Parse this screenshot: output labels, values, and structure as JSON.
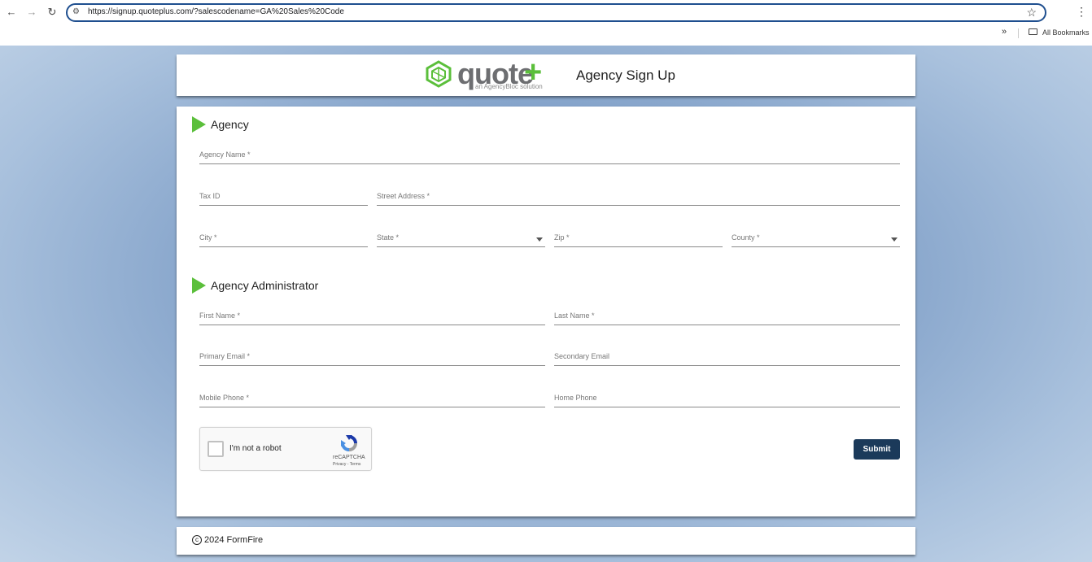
{
  "browser": {
    "url": "https://signup.quoteplus.com/?salescodename=GA%20Sales%20Code",
    "bookmarks_label": "All Bookmarks",
    "more_bookmarks": "»"
  },
  "header": {
    "logo_word": "quote",
    "logo_plus": "+",
    "logo_sub": "an AgencyBloc solution",
    "title": "Agency Sign Up"
  },
  "agency": {
    "section_title": "Agency",
    "agency_name": "Agency Name *",
    "tax_id": "Tax ID",
    "street_address": "Street Address *",
    "city": "City *",
    "state": "State *",
    "zip": "Zip *",
    "county": "County *"
  },
  "admin": {
    "section_title": "Agency Administrator",
    "first_name": "First Name *",
    "last_name": "Last Name *",
    "primary_email": "Primary Email *",
    "secondary_email": "Secondary Email",
    "mobile_phone": "Mobile Phone *",
    "home_phone": "Home Phone"
  },
  "captcha": {
    "label": "I'm not a robot",
    "brand": "reCAPTCHA",
    "links": "Privacy - Terms"
  },
  "submit_label": "Submit",
  "footer": {
    "text": "2024 FormFire"
  },
  "colors": {
    "accent_green": "#5bbf3b",
    "submit_navy": "#1b3a5a",
    "url_border": "#1f4f8f"
  }
}
